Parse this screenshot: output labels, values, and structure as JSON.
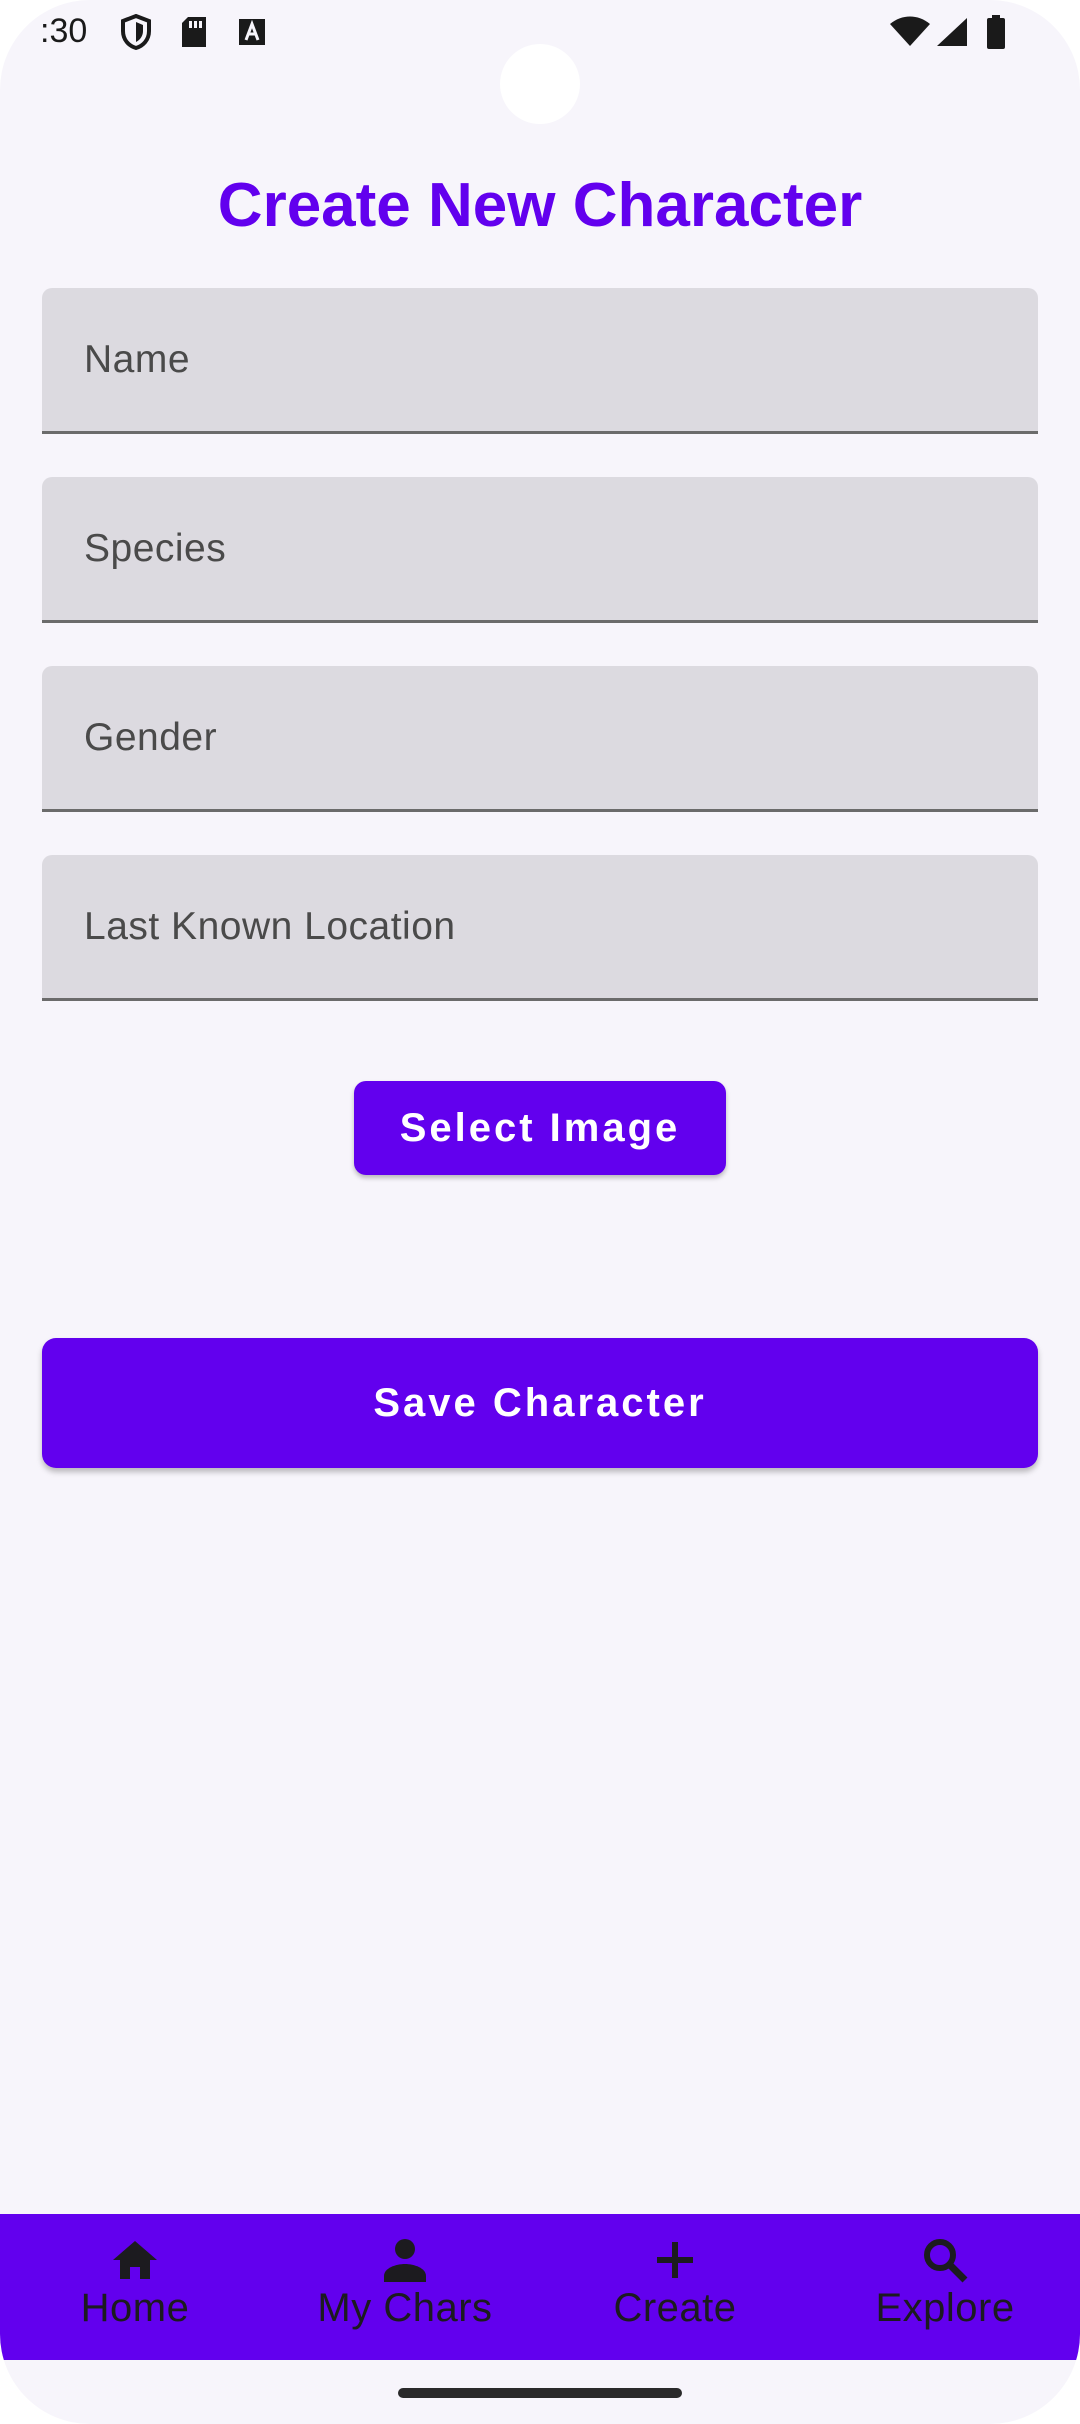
{
  "status_bar": {
    "time": ":30"
  },
  "page": {
    "title": "Create New Character"
  },
  "form": {
    "fields": [
      {
        "placeholder": "Name"
      },
      {
        "placeholder": "Species"
      },
      {
        "placeholder": "Gender"
      },
      {
        "placeholder": "Last Known Location"
      }
    ],
    "select_image_label": "Select Image",
    "save_label": "Save Character"
  },
  "bottom_nav": {
    "items": [
      {
        "label": "Home",
        "icon": "home-icon"
      },
      {
        "label": "My Chars",
        "icon": "person-icon"
      },
      {
        "label": "Create",
        "icon": "plus-icon"
      },
      {
        "label": "Explore",
        "icon": "search-icon"
      }
    ]
  },
  "colors": {
    "accent": "#6200EE",
    "background": "#F7F5FB",
    "field_fill": "#DCDAE0"
  }
}
